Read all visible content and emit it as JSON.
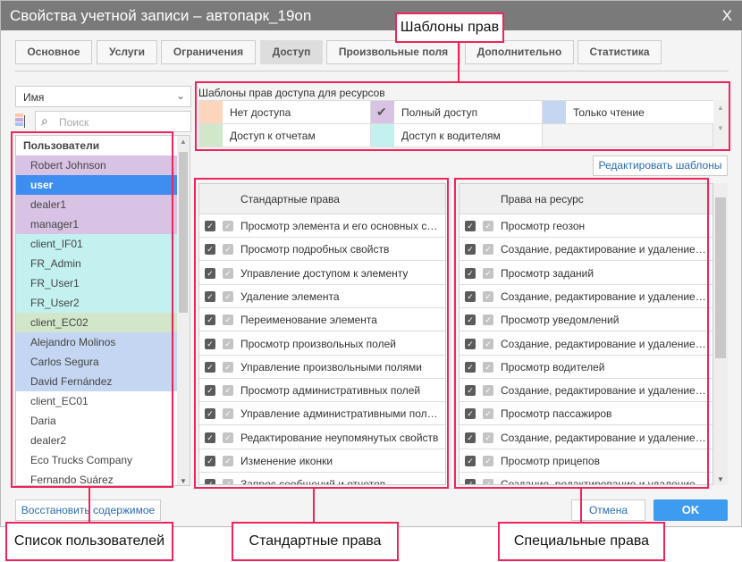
{
  "window": {
    "title": "Свойства учетной записи – автопарк_19on",
    "close": "X"
  },
  "tabs": [
    "Основное",
    "Услуги",
    "Ограничения",
    "Доступ",
    "Произвольные поля",
    "Дополнительно",
    "Статистика"
  ],
  "active_tab": "Доступ",
  "sort_select": {
    "value": "Имя",
    "chevron": "⌄"
  },
  "search": {
    "placeholder": "Поиск"
  },
  "users": {
    "header": "Пользователи",
    "items": [
      {
        "name": "Robert Johnson",
        "color": "#d9c3e5"
      },
      {
        "name": "user",
        "color": "#3d8ef0",
        "selected": true
      },
      {
        "name": "dealer1",
        "color": "#d9c3e5"
      },
      {
        "name": "manager1",
        "color": "#d9c3e5"
      },
      {
        "name": "client_IF01",
        "color": "#c2f1f0"
      },
      {
        "name": "FR_Admin",
        "color": "#c2f1f0"
      },
      {
        "name": "FR_User1",
        "color": "#c2f1f0"
      },
      {
        "name": "FR_User2",
        "color": "#c2f1f0"
      },
      {
        "name": "client_EC02",
        "color": "#d2e7c9"
      },
      {
        "name": "Alejandro Molinos",
        "color": "#c4d6f2"
      },
      {
        "name": "Carlos Segura",
        "color": "#c4d6f2"
      },
      {
        "name": "David Fernández",
        "color": "#c4d6f2"
      },
      {
        "name": "client_EC01",
        "color": "#ffffff"
      },
      {
        "name": "Daria",
        "color": "#ffffff"
      },
      {
        "name": "dealer2",
        "color": "#ffffff"
      },
      {
        "name": "Eco Trucks Company",
        "color": "#ffffff"
      },
      {
        "name": "Fernando Suárez",
        "color": "#ffffff"
      }
    ]
  },
  "templates": {
    "title": "Шаблоны прав доступа для ресурсов",
    "items": [
      {
        "label": "Нет доступа",
        "color": "#fbd6bc"
      },
      {
        "label": "Полный доступ",
        "color": "#d9c3e5",
        "checked": true
      },
      {
        "label": "Только чтение",
        "color": "#c4d6f2"
      },
      {
        "label": "Доступ к отчетам",
        "color": "#d2e7c9"
      },
      {
        "label": "Доступ к водителям",
        "color": "#c2f1f0"
      }
    ]
  },
  "edit_templates_label": "Редактировать шаблоны",
  "standard": {
    "header": "Стандартные права",
    "items": [
      "Просмотр элемента и его основных сво…",
      "Просмотр подробных свойств",
      "Управление доступом к элементу",
      "Удаление элемента",
      "Переименование элемента",
      "Просмотр произвольных полей",
      "Управление произвольными полями",
      "Просмотр административных полей",
      "Управление административными поля…",
      "Редактирование неупомянутых свойств",
      "Изменение иконки",
      "Запрос сообщений и отчетов"
    ]
  },
  "special": {
    "header": "Права на ресурс",
    "items": [
      "Просмотр геозон",
      "Создание, редактирование и удаление …",
      "Просмотр заданий",
      "Создание, редактирование и удаление …",
      "Просмотр уведомлений",
      "Создание, редактирование и удаление …",
      "Просмотр водителей",
      "Создание, редактирование и удаление …",
      "Просмотр пассажиров",
      "Создание, редактирование и удаление …",
      "Просмотр прицепов",
      "Создание, редактирование и удаление …"
    ]
  },
  "buttons": {
    "restore": "Восстановить содержимое",
    "cancel": "Отмена",
    "ok": "OK"
  },
  "callouts": {
    "templates": "Шаблоны прав",
    "users": "Список пользователей",
    "standard": "Стандартные права",
    "special": "Специальные права"
  }
}
